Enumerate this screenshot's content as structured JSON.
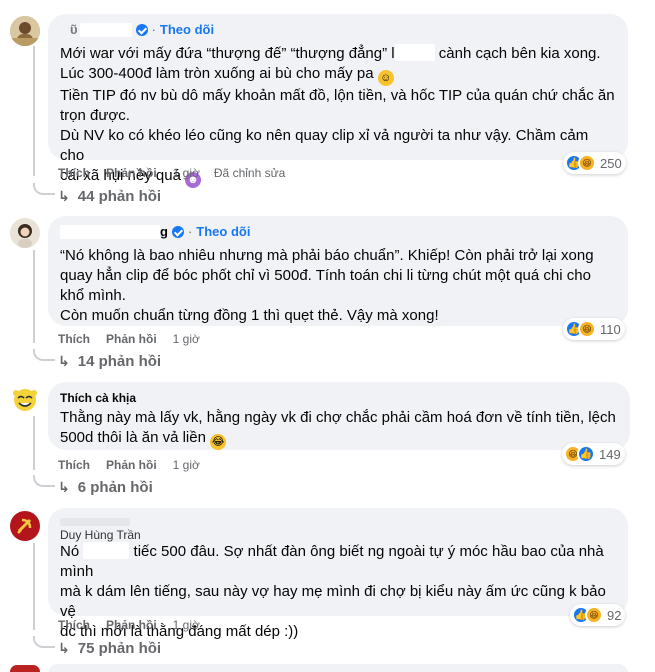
{
  "comments": [
    {
      "name_visible": "ῦ",
      "follow_label": "Theo dõi",
      "text_lines": [
        "Mới war với mấy đứa “thượng đế” “thượng đẳng” l",
        "cành cạch bên kia xong.",
        "Lúc 300-400đ làm tròn xuống ai bù cho mấy pa",
        "Tiền TIP đó nv bù dô mấy khoản mất đồ, lộn tiền, và hốc TIP của quán chứ chắc ăn",
        "trọn được.",
        "Dù NV ko có khéo léo cũng ko nên quay clip xỉ vả người ta như vậy. Chầm cảm cho",
        "cái xã hụi nềy quá"
      ],
      "actions": {
        "like": "Thích",
        "reply": "Phản hồi",
        "time": "1 giờ",
        "edited": "Đã chỉnh sửa"
      },
      "reaction_count": "250",
      "replies_label": "44 phản hồi"
    },
    {
      "name_visible": "g",
      "follow_label": "Theo dõi",
      "text_lines": [
        "“Nó không là bao nhiêu nhưng mà phải báo chuẩn”. Khiếp! Còn phải trở lại xong",
        "quay hẳn clip để bóc phốt chỉ vì 500đ. Tính toán chi li từng chút một quá chi cho",
        "khổ mình.",
        "Còn muốn chuẩn từng đồng 1 thì quẹt thẻ. Vậy mà xong!"
      ],
      "actions": {
        "like": "Thích",
        "reply": "Phản hồi",
        "time": "1 giờ"
      },
      "reaction_count": "110",
      "replies_label": "14 phản hồi"
    },
    {
      "name_visible": "Thích cà khịa",
      "text_lines": [
        "Thằng này mà lấy vk, hằng ngày vk đi chợ chắc phải cầm hoá đơn về tính tiền, lệch",
        "500d thôi là ăn vả liền"
      ],
      "actions": {
        "like": "Thích",
        "reply": "Phản hồi",
        "time": "1 giờ"
      },
      "reaction_count": "149",
      "replies_label": "6 phản hồi"
    },
    {
      "name_visible": "Duy Hùng Trần",
      "text_lines": [
        "Nó",
        "tiếc 500 đâu. Sợ nhất đàn ông biết ng ngoài tự ý móc hầu bao của nhà mình",
        "mà k dám lên tiếng, sau này vợ hay mẹ mình đi chợ bị kiểu này ấm ức cũng k bảo vệ",
        "đc thì mới là thằng đáng mất dép :))"
      ],
      "actions": {
        "like": "Thích",
        "reply": "Phản hồi",
        "time": "1 giờ"
      },
      "reaction_count": "92",
      "replies_label": "75 phản hồi"
    }
  ],
  "icons": {
    "like": "like-icon",
    "haha": "haha-icon",
    "verified": "verified-badge-icon",
    "reply_arrow": "reply-arrow-icon"
  },
  "colors": {
    "accent": "#1877f2",
    "bubble": "#f0f2f5",
    "muted": "#65676b"
  }
}
